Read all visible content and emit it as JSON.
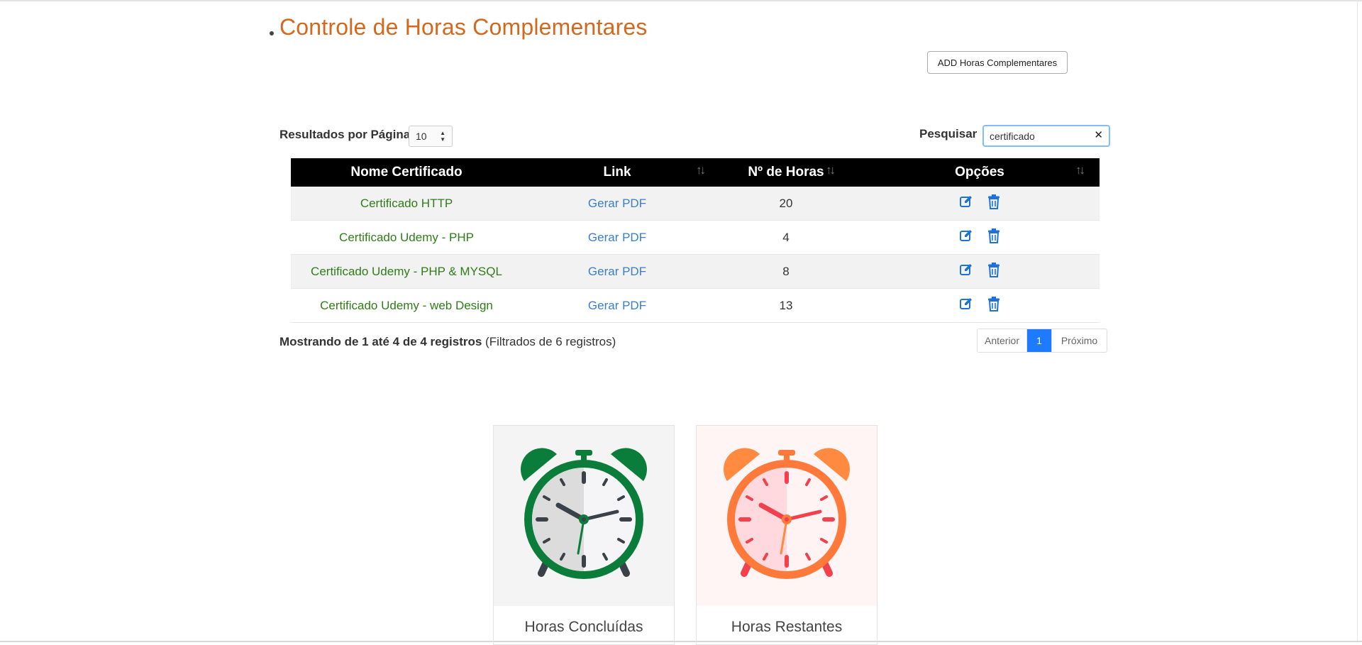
{
  "page": {
    "title": "Controle de Horas Complementares",
    "add_button_label": "ADD Horas Complementares"
  },
  "controls": {
    "length_label": "Resultados por Página",
    "length_value": "10",
    "search_label": "Pesquisar",
    "search_value": "certificado"
  },
  "table": {
    "columns": [
      "Nome Certificado",
      "Link",
      "Nº de Horas",
      "Opções"
    ],
    "rows": [
      {
        "name": "Certificado HTTP",
        "link": "Gerar PDF",
        "hours": "20"
      },
      {
        "name": "Certificado Udemy - PHP",
        "link": "Gerar PDF",
        "hours": "4"
      },
      {
        "name": "Certificado Udemy - PHP & MYSQL",
        "link": "Gerar PDF",
        "hours": "8"
      },
      {
        "name": "Certificado Udemy - web Design",
        "link": "Gerar PDF",
        "hours": "13"
      }
    ],
    "row_icons": [
      "edit-icon",
      "trash-icon"
    ]
  },
  "footer": {
    "info_main": "Mostrando de 1 até 4 de 4 registros",
    "info_filtered": "(Filtrados de 6 registros)",
    "pagination": {
      "prev": "Anterior",
      "current": "1",
      "next": "Próximo"
    }
  },
  "cards": [
    {
      "label": "Horas Concluídas",
      "icon": "alarm-clock-green-icon"
    },
    {
      "label": "Horas Restantes",
      "icon": "alarm-clock-orange-icon"
    }
  ],
  "colors": {
    "title": "#d2691e",
    "cert_name": "#2e7d16",
    "link": "#3a7fc4",
    "icon_blue": "#1e73d8",
    "header_bg": "#000000",
    "page_active": "#1e7bff",
    "clock_green": "#0a7d3b",
    "clock_orange": "#ff7a3a",
    "clock_red": "#f2404c"
  }
}
